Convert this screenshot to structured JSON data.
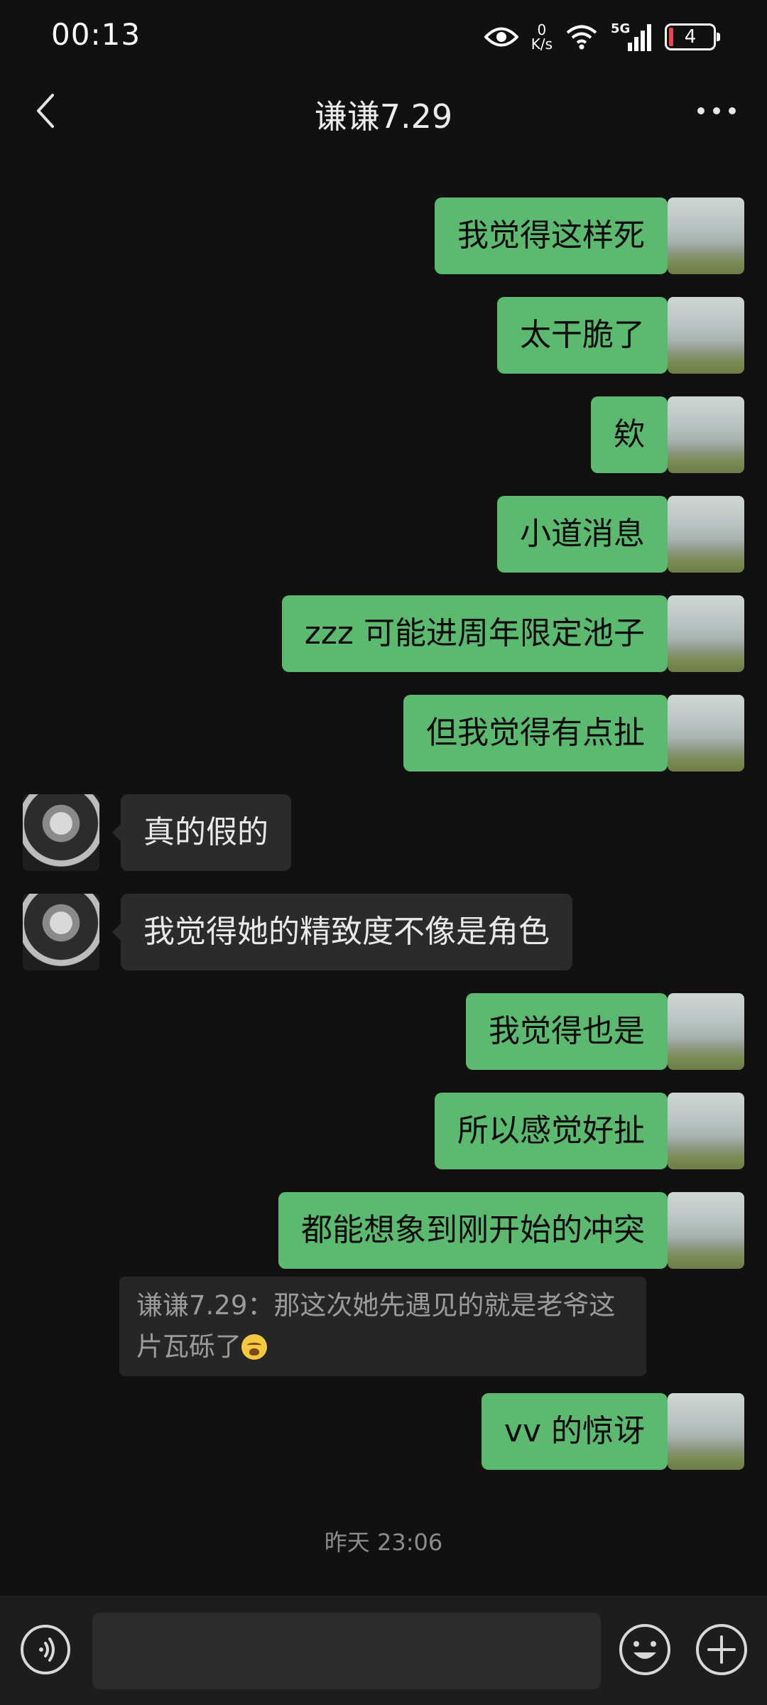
{
  "status_bar": {
    "time": "00:13",
    "net_speed_value": "0",
    "net_speed_unit": "K/s",
    "network": "5G",
    "battery_level": "4",
    "icons": [
      "eye-icon",
      "wifi-icon",
      "signal-icon",
      "battery-icon"
    ]
  },
  "header": {
    "title": "谦谦7.29",
    "back_icon": "back-arrow-icon",
    "more_icon": "more-dots-icon"
  },
  "messages": [
    {
      "side": "out",
      "text": "我觉得这样死"
    },
    {
      "side": "out",
      "text": "太干脆了"
    },
    {
      "side": "out",
      "text": "欸"
    },
    {
      "side": "out",
      "text": "小道消息"
    },
    {
      "side": "out",
      "text": "zzz 可能进周年限定池子"
    },
    {
      "side": "out",
      "text": "但我觉得有点扯"
    },
    {
      "side": "in",
      "text": "真的假的"
    },
    {
      "side": "in",
      "text": "我觉得她的精致度不像是角色"
    },
    {
      "side": "out",
      "text": "我觉得也是"
    },
    {
      "side": "out",
      "text": "所以感觉好扯"
    },
    {
      "side": "out",
      "text": "都能想象到刚开始的冲突"
    },
    {
      "side": "out",
      "text": "vv 的惊讶"
    }
  ],
  "quote": {
    "text": "谦谦7.29：那这次她先遇见的就是老爷这片瓦砾了",
    "emoji": "crying-face-emoji"
  },
  "timestamp": "昨天 23:06",
  "input_bar": {
    "voice_icon": "voice-icon",
    "text_value": "",
    "emoji_icon": "emoji-icon",
    "plus_icon": "plus-icon"
  },
  "colors": {
    "background": "#111111",
    "outgoing_bubble": "#5bba6f",
    "incoming_bubble": "#2b2b2b",
    "input_bar": "#1d1d1d"
  }
}
